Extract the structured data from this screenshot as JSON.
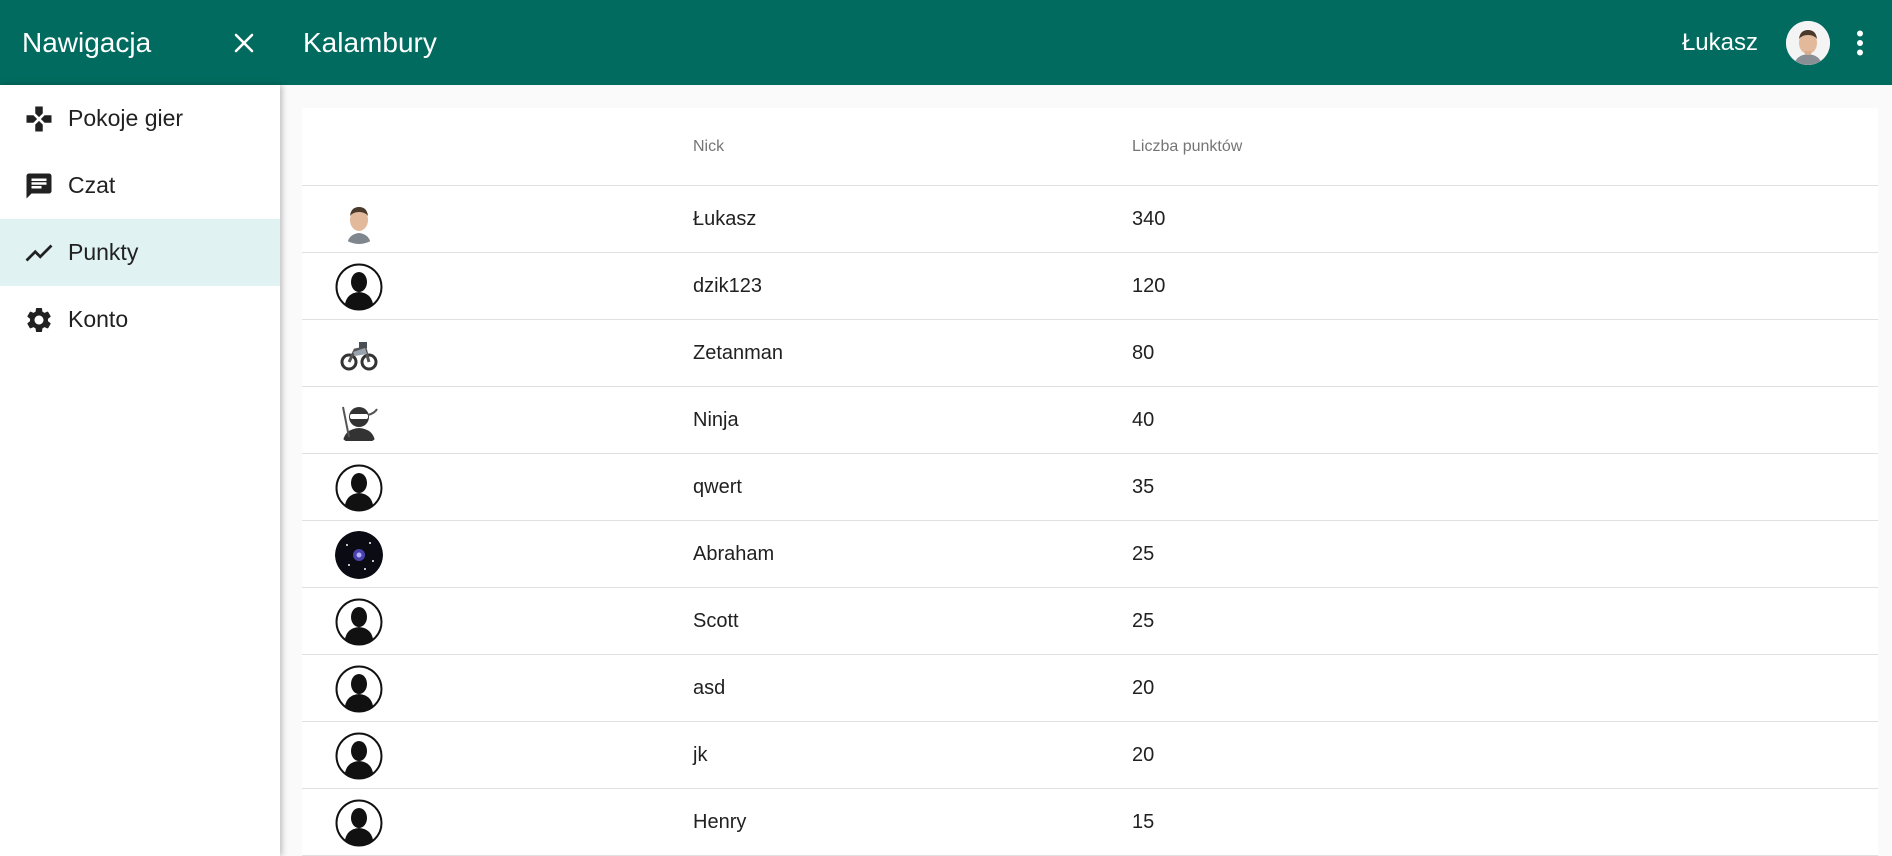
{
  "drawer": {
    "title": "Nawigacja",
    "items": [
      {
        "label": "Pokoje gier",
        "icon": "gamepad-icon",
        "active": false
      },
      {
        "label": "Czat",
        "icon": "chat-icon",
        "active": false
      },
      {
        "label": "Punkty",
        "icon": "trending-up-icon",
        "active": true
      },
      {
        "label": "Konto",
        "icon": "gear-icon",
        "active": false
      }
    ]
  },
  "header": {
    "title": "Kalambury",
    "user_name": "Łukasz",
    "brand_color": "#006b5e"
  },
  "table": {
    "columns": [
      "",
      "Nick",
      "Liczba punktów"
    ],
    "rows": [
      {
        "nick": "Łukasz",
        "points": "340",
        "avatar": "photo-face"
      },
      {
        "nick": "dzik123",
        "points": "120",
        "avatar": "default-silhouette"
      },
      {
        "nick": "Zetanman",
        "points": "80",
        "avatar": "motorcycle"
      },
      {
        "nick": "Ninja",
        "points": "40",
        "avatar": "ninja"
      },
      {
        "nick": "qwert",
        "points": "35",
        "avatar": "default-silhouette"
      },
      {
        "nick": "Abraham",
        "points": "25",
        "avatar": "galaxy"
      },
      {
        "nick": "Scott",
        "points": "25",
        "avatar": "default-silhouette"
      },
      {
        "nick": "asd",
        "points": "20",
        "avatar": "default-silhouette"
      },
      {
        "nick": "jk",
        "points": "20",
        "avatar": "default-silhouette"
      },
      {
        "nick": "Henry",
        "points": "15",
        "avatar": "default-silhouette"
      }
    ]
  }
}
